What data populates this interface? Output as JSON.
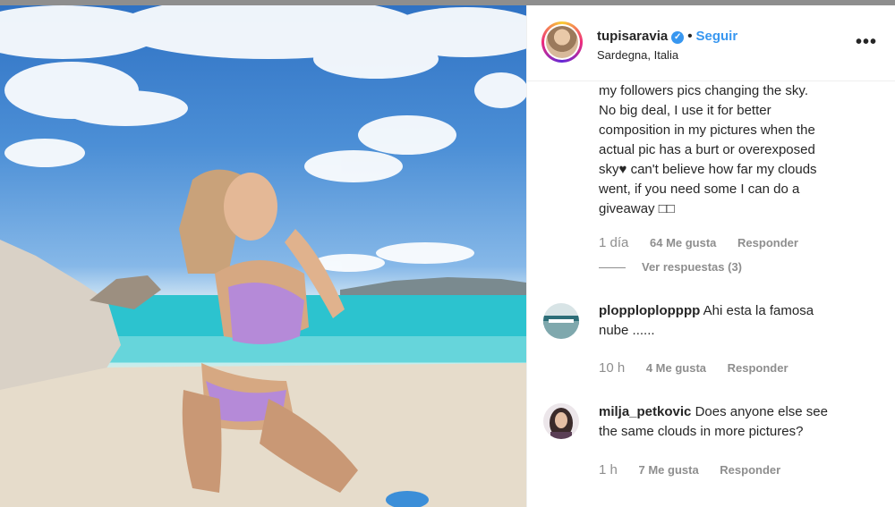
{
  "post": {
    "username": "tupisaravia",
    "separator": "•",
    "follow_label": "Seguir",
    "location": "Sardegna, Italia",
    "more_label": "•••",
    "verified_glyph": "✓"
  },
  "comments": [
    {
      "lines": [
        "my followers pics changing the sky.",
        "No big deal, I use it for better",
        "composition in my pictures when the",
        "actual pic has a burt or overexposed",
        "sky♥ can't believe how far my clouds",
        "went, if you need some I can do a",
        "giveaway □□"
      ],
      "time": "1 día",
      "likes": "64 Me gusta",
      "reply_label": "Responder",
      "view_replies": "Ver respuestas (3)"
    },
    {
      "username": "plopploplopppp",
      "text_line1": "Ahi esta la famosa",
      "text_line2": "nube ......",
      "time": "10 h",
      "likes": "4 Me gusta",
      "reply_label": "Responder"
    },
    {
      "username": "milja_petkovic",
      "text_line1": "Does anyone else see",
      "text_line2": "the same clouds in more pictures?",
      "time": "1 h",
      "likes": "7 Me gusta",
      "reply_label": "Responder"
    }
  ],
  "colors": {
    "link_blue": "#3897f0",
    "text": "#262626",
    "meta_gray": "#8e8e8e"
  }
}
